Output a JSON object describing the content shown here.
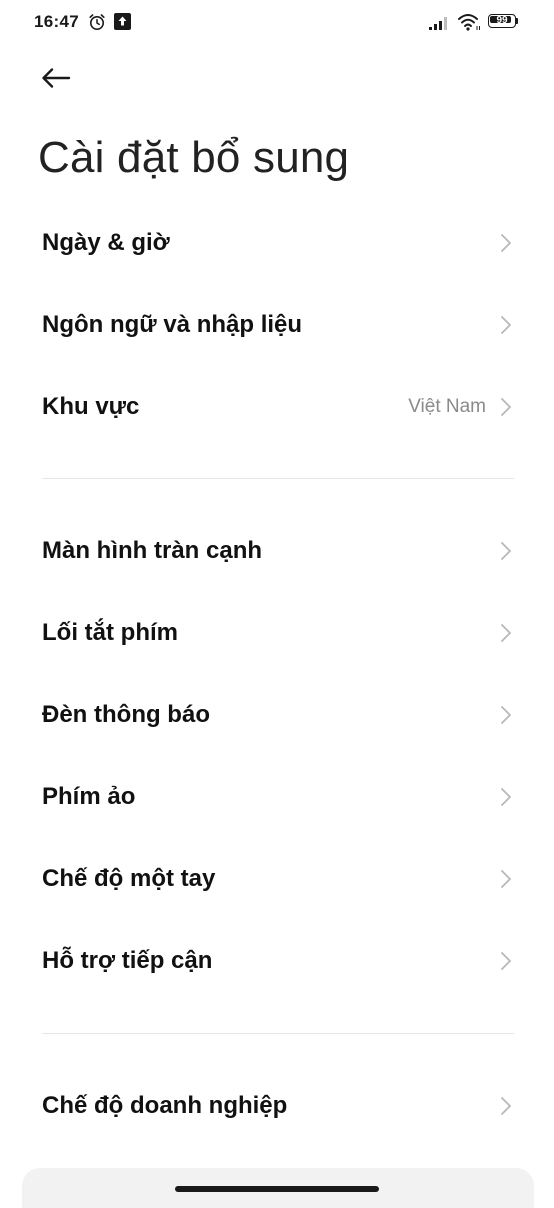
{
  "status_bar": {
    "time": "16:47",
    "battery": "99",
    "icons": [
      "alarm-icon",
      "upload-icon",
      "signal-icon",
      "wifi-icon",
      "battery-icon"
    ]
  },
  "header": {
    "back_icon": "arrow-left-icon",
    "title": "Cài đặt bổ sung"
  },
  "sections": [
    {
      "items": [
        {
          "label": "Ngày & giờ",
          "value": ""
        },
        {
          "label": "Ngôn ngữ và nhập liệu",
          "value": ""
        },
        {
          "label": "Khu vực",
          "value": "Việt Nam"
        }
      ]
    },
    {
      "items": [
        {
          "label": "Màn hình tràn cạnh",
          "value": ""
        },
        {
          "label": "Lối tắt phím",
          "value": ""
        },
        {
          "label": "Đèn thông báo",
          "value": ""
        },
        {
          "label": "Phím ảo",
          "value": ""
        },
        {
          "label": "Chế độ một tay",
          "value": ""
        },
        {
          "label": "Hỗ trợ tiếp cận",
          "value": ""
        }
      ]
    },
    {
      "items": [
        {
          "label": "Chế độ doanh nghiệp",
          "value": ""
        }
      ]
    }
  ],
  "colors": {
    "background": "#ffffff",
    "text": "#111111",
    "secondary_text": "#8a8a8a",
    "chevron": "#b8b8b8",
    "divider": "#e6e6e6"
  }
}
